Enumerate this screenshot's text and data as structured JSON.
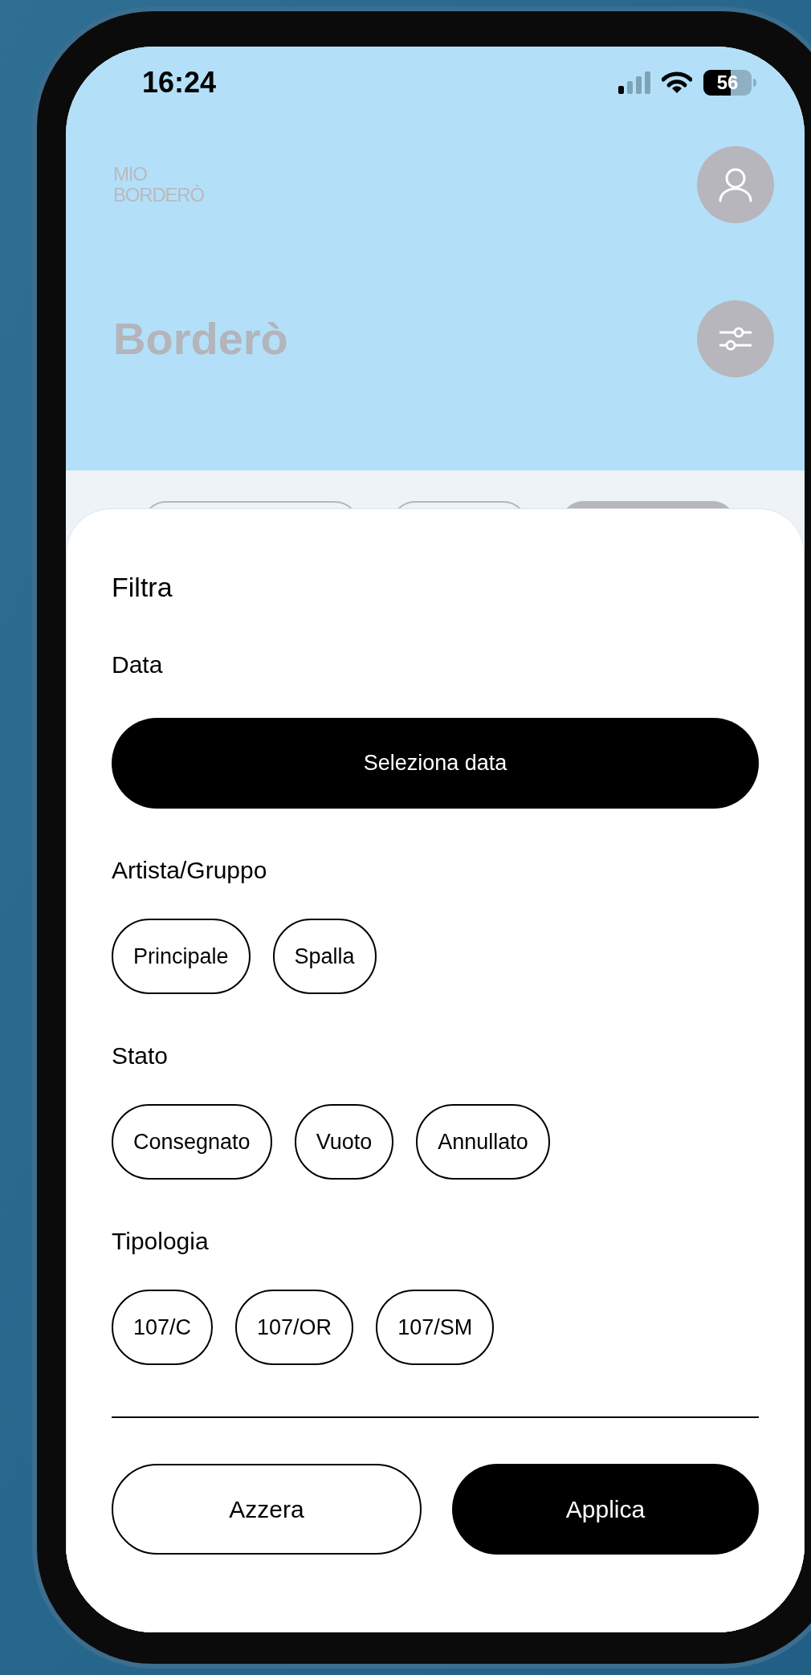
{
  "status_bar": {
    "time": "16:24",
    "battery": "56"
  },
  "header": {
    "logo": [
      "MIO",
      "BORDERÒ"
    ],
    "title": "Borderò"
  },
  "filter_sheet": {
    "title": "Filtra",
    "sections": [
      {
        "kind": "button",
        "heading": "Data",
        "button": "Seleziona data"
      },
      {
        "kind": "chips",
        "heading": "Artista/Gruppo",
        "chips": [
          {
            "label": "Principale",
            "selected": false
          },
          {
            "label": "Spalla",
            "selected": false
          }
        ]
      },
      {
        "kind": "chips",
        "heading": "Stato",
        "chips": [
          {
            "label": "Consegnato",
            "selected": false
          },
          {
            "label": "Vuoto",
            "selected": false
          },
          {
            "label": "Annullato",
            "selected": false
          }
        ]
      },
      {
        "kind": "chips",
        "heading": "Tipologia",
        "chips": [
          {
            "label": "107/C",
            "selected": false
          },
          {
            "label": "107/OR",
            "selected": false
          },
          {
            "label": "107/SM",
            "selected": false
          }
        ]
      }
    ],
    "actions": [
      {
        "label": "Azzera",
        "kind": "secondary"
      },
      {
        "label": "Applica",
        "kind": "primary"
      }
    ]
  }
}
